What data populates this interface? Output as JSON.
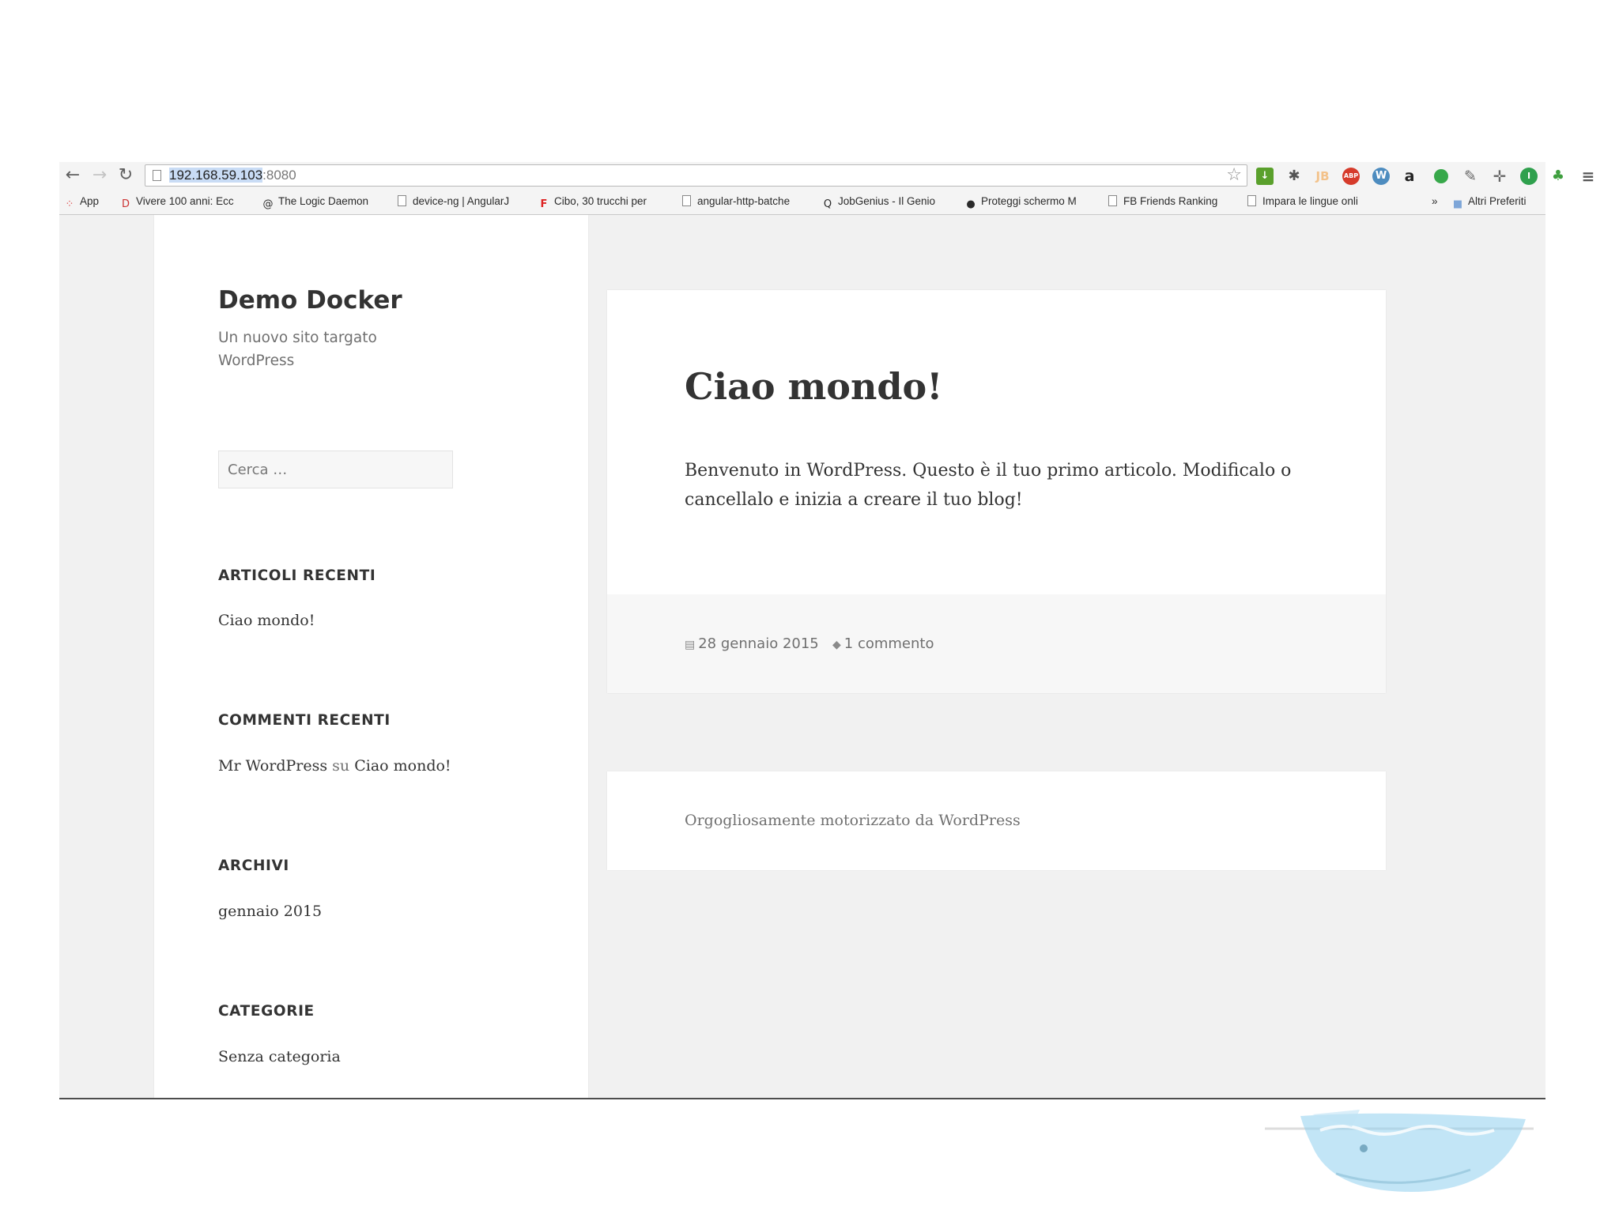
{
  "browser": {
    "url_host": "192.168.59.103",
    "url_port": ":8080",
    "bookmarks": [
      {
        "label": "App",
        "icon": "apps-grid-icon"
      },
      {
        "label": "Vivere 100 anni: Ecc",
        "icon": "site-favicon-icon"
      },
      {
        "label": "The Logic Daemon",
        "icon": "at-sign-icon"
      },
      {
        "label": "device-ng | AngularJ",
        "icon": "document-icon"
      },
      {
        "label": "Cibo, 30 trucchi per",
        "icon": "flipboard-f-icon"
      },
      {
        "label": "angular-http-batche",
        "icon": "document-icon"
      },
      {
        "label": "JobGenius - Il Genio",
        "icon": "search-q-icon"
      },
      {
        "label": "Proteggi schermo M",
        "icon": "apple-icon"
      },
      {
        "label": "FB Friends Ranking",
        "icon": "document-icon"
      },
      {
        "label": "Impara le lingue onli",
        "icon": "document-icon"
      }
    ],
    "more_label": "»",
    "other_bookmarks": "Altri Preferiti"
  },
  "sidebar": {
    "site_title": "Demo Docker",
    "site_description": "Un nuovo sito targato WordPress",
    "search_placeholder": "Cerca …",
    "recent_posts_title": "ARTICOLI RECENTI",
    "recent_post": "Ciao mondo!",
    "recent_comments_title": "COMMENTI RECENTI",
    "comment_author": "Mr WordPress",
    "comment_on": "su",
    "comment_post": "Ciao mondo!",
    "archives_title": "ARCHIVI",
    "archive_item": "gennaio 2015",
    "categories_title": "CATEGORIE",
    "category_item": "Senza categoria"
  },
  "post": {
    "title": "Ciao mondo!",
    "content": "Benvenuto in WordPress. Questo è il tuo primo articolo. Modificalo o cancellalo e inizia a creare il tuo blog!",
    "date": "28 gennaio 2015",
    "comments": "1 commento"
  },
  "footer": {
    "credit": "Orgogliosamente motorizzato da WordPress"
  },
  "colors": {
    "page_background": "#f1f1f1",
    "text_primary": "#333333",
    "text_secondary": "#707070",
    "selection_highlight": "#c9dcf5"
  }
}
